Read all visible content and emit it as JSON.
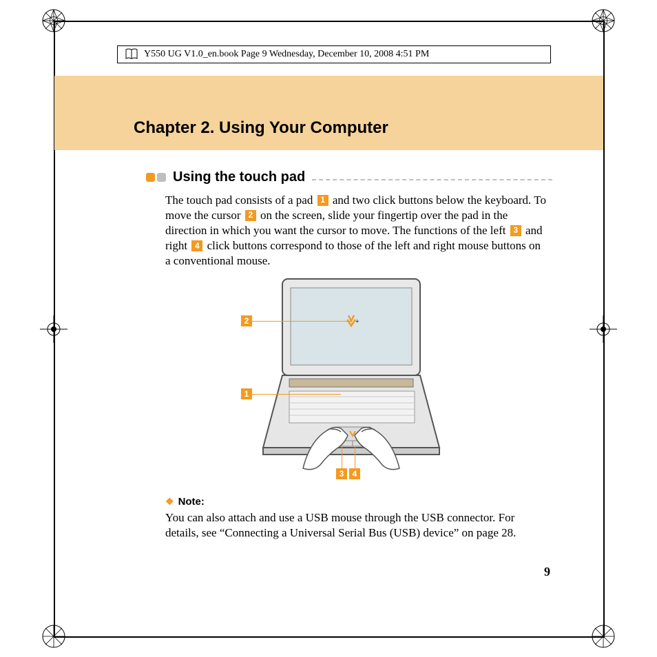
{
  "header": "Y550 UG V1.0_en.book  Page 9  Wednesday, December 10, 2008  4:51 PM",
  "chapter_title": "Chapter 2. Using Your Computer",
  "section_title": "Using the touch pad",
  "callouts": {
    "c1": "1",
    "c2": "2",
    "c3": "3",
    "c4": "4"
  },
  "body": {
    "p1a": "The touch pad consists of a pad ",
    "p1b": " and two click buttons below the keyboard. To move the cursor ",
    "p1c": " on the screen, slide your fingertip over the pad in the direction in which you want the cursor to move. The functions of the left ",
    "p1d": " and right ",
    "p1e": " click buttons correspond to those of the left and right mouse buttons on a conventional mouse."
  },
  "note": {
    "label": "Note:",
    "text": "You can also attach and use a USB mouse through the USB connector. For details, see “Connecting a Universal Serial Bus (USB) device” on page 28."
  },
  "page_number": "9"
}
